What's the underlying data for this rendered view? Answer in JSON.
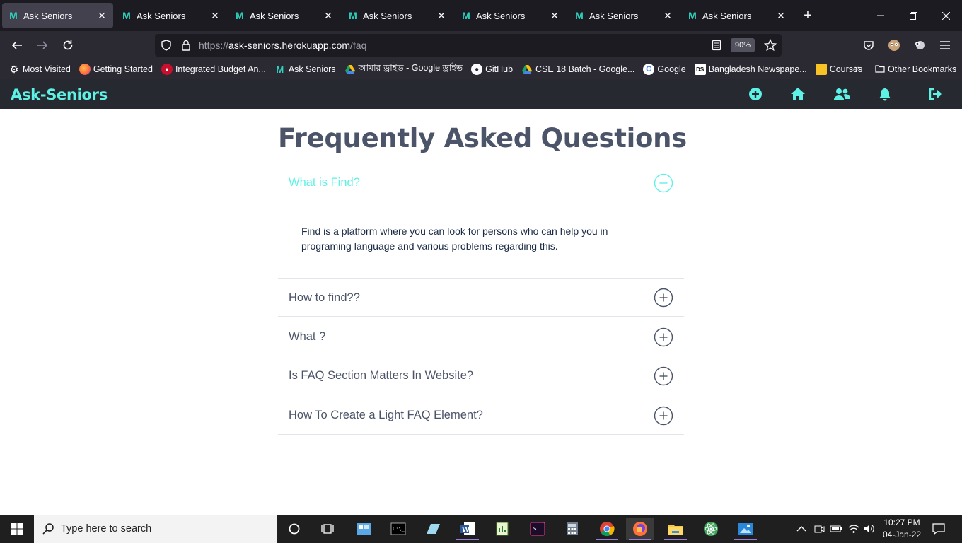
{
  "browser": {
    "tabs": [
      {
        "label": "Ask Seniors",
        "active": true
      },
      {
        "label": "Ask Seniors",
        "active": false
      },
      {
        "label": "Ask Seniors",
        "active": false
      },
      {
        "label": "Ask Seniors",
        "active": false
      },
      {
        "label": "Ask Seniors",
        "active": false
      },
      {
        "label": "Ask Seniors",
        "active": false
      },
      {
        "label": "Ask Seniors",
        "active": false
      }
    ],
    "url_prefix": "https://",
    "url_host": "ask-seniors.herokuapp.com",
    "url_path": "/faq",
    "zoom": "90%",
    "bookmarks": [
      {
        "label": "Most Visited",
        "icon": "gear-icon"
      },
      {
        "label": "Getting Started",
        "icon": "firefox-icon"
      },
      {
        "label": "Integrated Budget An...",
        "icon": "budget-icon"
      },
      {
        "label": "Ask Seniors",
        "icon": "ask-seniors-icon"
      },
      {
        "label": "আমার ড্রাইভ - Google ড্রাইভ",
        "icon": "google-drive-icon"
      },
      {
        "label": "GitHub",
        "icon": "github-icon"
      },
      {
        "label": "CSE 18 Batch - Google...",
        "icon": "google-drive-icon"
      },
      {
        "label": "Google",
        "icon": "google-icon"
      },
      {
        "label": "Bangladesh Newspape...",
        "icon": "newspaper-icon"
      },
      {
        "label": "Courses",
        "icon": "classroom-icon"
      }
    ],
    "other_bookmarks": "Other Bookmarks"
  },
  "app": {
    "brand": "Ask-Seniors",
    "nav_icons": [
      "add-circle-icon",
      "home-icon",
      "users-icon",
      "bell-icon",
      "sign-out-icon"
    ],
    "accent": "#5ef2e6",
    "header_bg": "#262a30",
    "text_color": "#4b5468"
  },
  "faq": {
    "title": "Frequently Asked Questions",
    "items": [
      {
        "question": "What is Find?",
        "open": true,
        "answer": "Find is a platform where you can look for persons who can help you in programing language and various problems regarding this."
      },
      {
        "question": "How to find??",
        "open": false
      },
      {
        "question": "What ?",
        "open": false
      },
      {
        "question": "Is FAQ Section Matters In Website?",
        "open": false
      },
      {
        "question": "How To Create a Light FAQ Element?",
        "open": false
      }
    ]
  },
  "taskbar": {
    "search_placeholder": "Type here to search",
    "time": "10:27 PM",
    "date": "04-Jan-22"
  }
}
